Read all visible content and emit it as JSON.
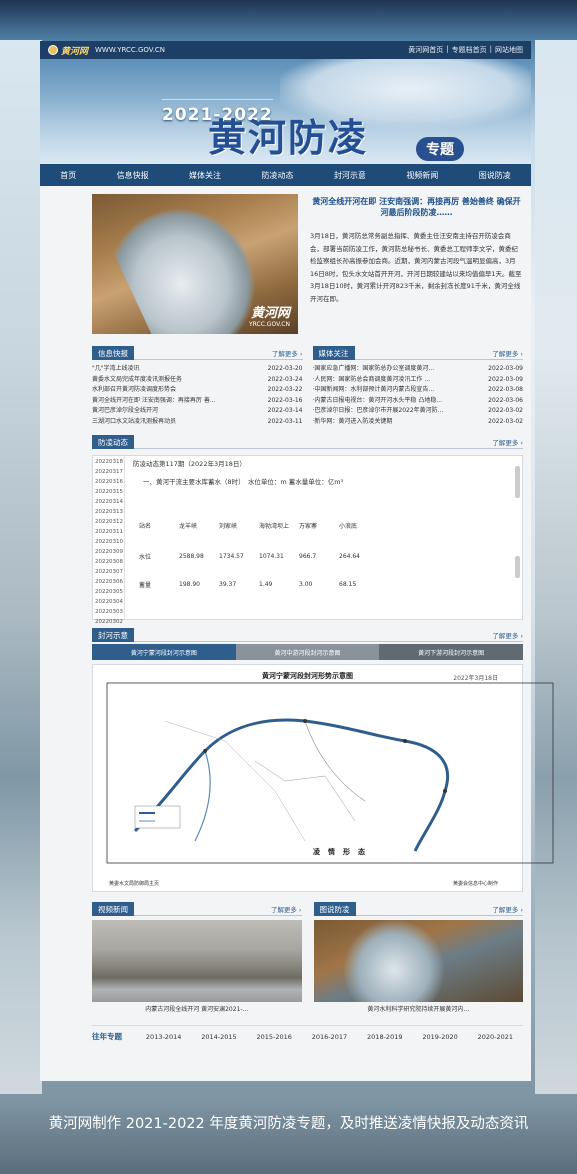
{
  "topbar": {
    "site": "黄河网",
    "url": "WWW.YRCC.GOV.CN",
    "links": [
      "黄河网首页",
      "专题档首页",
      "网站地图"
    ]
  },
  "banner": {
    "years": "2021-2022",
    "title": "黄河防凌",
    "tag": "专题"
  },
  "nav": [
    "首页",
    "信息快报",
    "媒体关注",
    "防凌动态",
    "封河示意",
    "视频新闻",
    "图说防凌"
  ],
  "feature": {
    "watermark": "黄河网",
    "watermark_url": "YRCC.GOV.CN",
    "title": "黄河全线开河在即 汪安南强调：再接再厉 善始善终 确保开河最后阶段防凌……",
    "body": "3月18日，黄河防总常务副总指挥、黄委主任汪安南主持召开防凌会商会，部署当前防凌工作，黄河防总秘书长、黄委总工程师李文学，黄委纪检监察组长孙高振参加会商。近期，黄河内蒙古河段气温明显偏高，3月16日8时，包头水文站首开开河，开河日期较建站以来均值偏早1天。截至3月18日10时，黄河累计开河823千米，剩余封冻长度91千米，黄河全线开河在即。"
  },
  "news": {
    "title": "信息快报",
    "more": "了解更多",
    "items": [
      {
        "t": "\"几\"字湾上线凌讯",
        "d": "2022-03-20"
      },
      {
        "t": "黄委水文局完成年度凌讯测报任务",
        "d": "2022-03-24"
      },
      {
        "t": "水利部召开黄河防凌调度形势会",
        "d": "2022-03-22"
      },
      {
        "t": "黄河全线开河在即 汪安南强调：再接再厉 善...",
        "d": "2022-03-16"
      },
      {
        "t": "黄河巴彦淖尔段全线开河",
        "d": "2022-03-14"
      },
      {
        "t": "三湖河口水文站凌汛测报再动员",
        "d": "2022-03-11"
      }
    ]
  },
  "media": {
    "title": "媒体关注",
    "more": "了解更多",
    "items": [
      {
        "t": "·国家应急广播网：国家防总办公室调度黄河...",
        "d": "2022-03-09"
      },
      {
        "t": "·人民网：国家防总会商调度黄河凌汛工作 ...",
        "d": "2022-03-09"
      },
      {
        "t": "·中国新闻网：水利部预计黄河内蒙古段宣告...",
        "d": "2022-03-08"
      },
      {
        "t": "·内蒙古日报电视台：黄河开河水头平稳 凸地稳...",
        "d": "2022-03-06"
      },
      {
        "t": "·巴彦淖尔日报：巴彦淖尔市开展2022年黄河防...",
        "d": "2022-03-02"
      },
      {
        "t": "·新华网：黄河进入防凌关键期",
        "d": "2022-03-02"
      }
    ]
  },
  "dynamics": {
    "title": "防凌动态",
    "more": "了解更多",
    "dates": [
      "20220318",
      "20220317",
      "20220316",
      "20220315",
      "20220314",
      "20220313",
      "20220312",
      "20220311",
      "20220310",
      "20220309",
      "20220308",
      "20220307",
      "20220306",
      "20220305",
      "20220304",
      "20220303",
      "20220302"
    ],
    "doc_title": "防凌动态第117期（2022年3月18日）",
    "doc_sub": "一、黄河干流主要水库蓄水（8时）　水位单位：m 蓄水量单位：亿m³",
    "table_header": [
      "站名",
      "龙羊峡",
      "刘家峡",
      "海勃湾坝上",
      "万家寨",
      "小浪底"
    ],
    "table_rows": [
      [
        "水位",
        "2588.98",
        "1734.57",
        "1074.31",
        "966.7",
        "264.64"
      ],
      [
        "蓄量",
        "198.90",
        "39.37",
        "1.49",
        "3.00",
        "68.15"
      ]
    ]
  },
  "maps": {
    "title": "封河示意",
    "more": "了解更多",
    "tabs": [
      "黄河宁蒙河段封河示意图",
      "黄河中游河段封河示意图",
      "黄河下游河段封河示意图"
    ],
    "map_title": "黄河宁蒙河段封河形势示意图",
    "map_date": "2022年3月18日",
    "map_center": "凌情形态",
    "foot_left": "黄委水文局防御局主页",
    "foot_right": "黄委会信息中心制作"
  },
  "videos": {
    "title": "视频新闻",
    "more": "了解更多",
    "caption": "内蒙古河段全线开河 黄河安澜2021-..."
  },
  "photos": {
    "title": "图说防凌",
    "more": "了解更多",
    "caption": "黄河水利科学研究院持续开展黄河内..."
  },
  "history": {
    "label": "往年专题",
    "years": [
      "2013-2014",
      "2014-2015",
      "2015-2016",
      "2016-2017",
      "2018-2019",
      "2019-2020",
      "2020-2021"
    ]
  },
  "caption": "黄河网制作 2021-2022 年度黄河防凌专题，及时推送凌情快报及动态资讯",
  "colors": {
    "navbar": "#1e4b78",
    "section": "#2f5e8d",
    "tab_active": "#2f5e8d",
    "tab_inactive": "#8a939b"
  }
}
